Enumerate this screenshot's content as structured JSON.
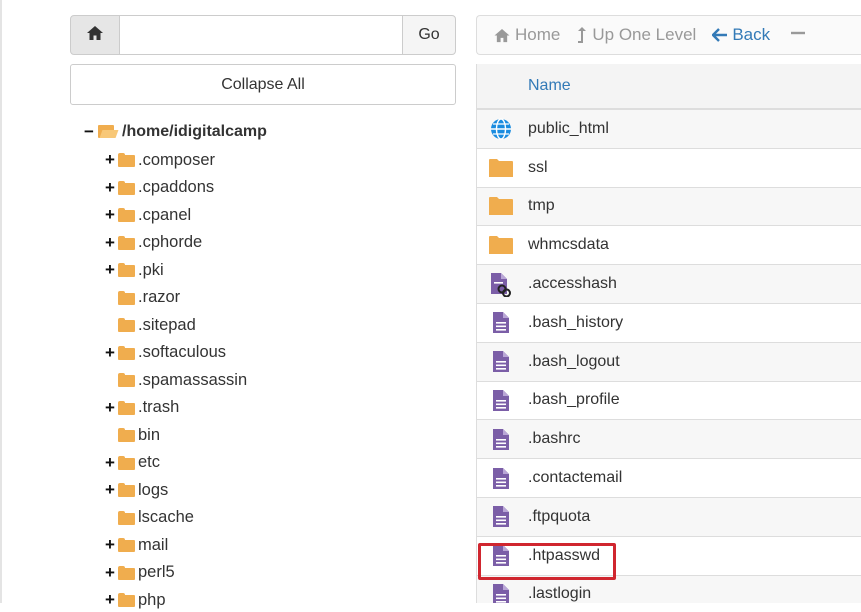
{
  "left_panel": {
    "go_label": "Go",
    "path_value": "",
    "collapse_label": "Collapse All",
    "tree": {
      "root": "/home/idigitalcamp",
      "items": [
        {
          "label": ".composer",
          "expandable": true
        },
        {
          "label": ".cpaddons",
          "expandable": true
        },
        {
          "label": ".cpanel",
          "expandable": true
        },
        {
          "label": ".cphorde",
          "expandable": true
        },
        {
          "label": ".pki",
          "expandable": true
        },
        {
          "label": ".razor",
          "expandable": false
        },
        {
          "label": ".sitepad",
          "expandable": false
        },
        {
          "label": ".softaculous",
          "expandable": true
        },
        {
          "label": ".spamassassin",
          "expandable": false
        },
        {
          "label": ".trash",
          "expandable": true
        },
        {
          "label": "bin",
          "expandable": false
        },
        {
          "label": "etc",
          "expandable": true
        },
        {
          "label": "logs",
          "expandable": true
        },
        {
          "label": "lscache",
          "expandable": false
        },
        {
          "label": "mail",
          "expandable": true
        },
        {
          "label": "perl5",
          "expandable": true
        },
        {
          "label": "php",
          "expandable": true
        }
      ]
    }
  },
  "toolbar": {
    "home_label": "Home",
    "up_label": "Up One Level",
    "back_label": "Back"
  },
  "table": {
    "name_header": "Name",
    "files": [
      {
        "name": "public_html",
        "icon": "globe-icon"
      },
      {
        "name": "ssl",
        "icon": "folder-icon"
      },
      {
        "name": "tmp",
        "icon": "folder-icon"
      },
      {
        "name": "whmcsdata",
        "icon": "folder-icon"
      },
      {
        "name": ".accesshash",
        "icon": "file-link-icon"
      },
      {
        "name": ".bash_history",
        "icon": "file-text-icon"
      },
      {
        "name": ".bash_logout",
        "icon": "file-text-icon"
      },
      {
        "name": ".bash_profile",
        "icon": "file-text-icon"
      },
      {
        "name": ".bashrc",
        "icon": "file-text-icon"
      },
      {
        "name": ".contactemail",
        "icon": "file-text-icon"
      },
      {
        "name": ".ftpquota",
        "icon": "file-text-icon"
      },
      {
        "name": ".htpasswd",
        "icon": "file-text-icon"
      },
      {
        "name": ".lastlogin",
        "icon": "file-text-icon"
      }
    ]
  },
  "colors": {
    "folder": "#f0ad4e",
    "file": "#7b5ea7",
    "link_blue": "#337ab7",
    "highlight": "#d0262f"
  }
}
